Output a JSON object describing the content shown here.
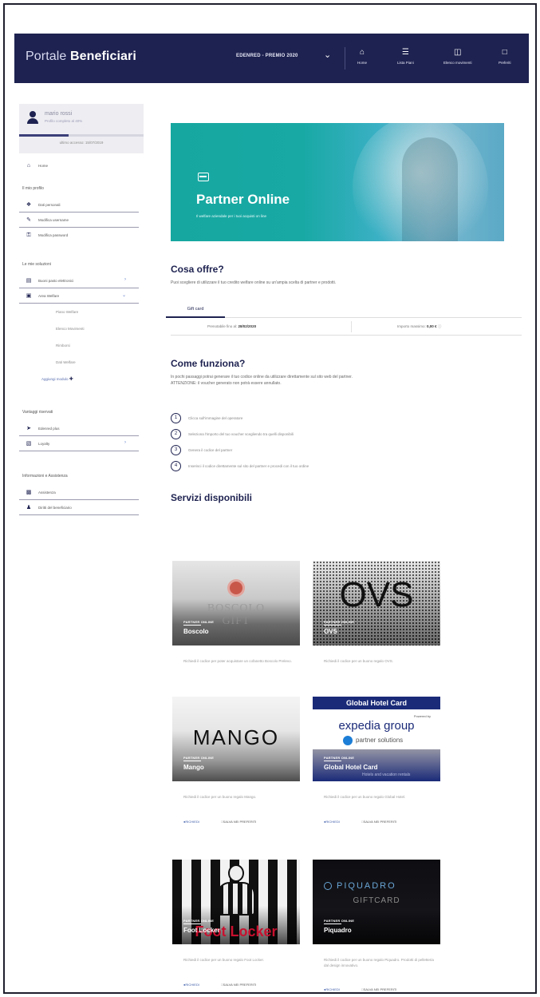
{
  "header": {
    "brand_light": "Portale ",
    "brand_bold": "Beneficiari",
    "program": "EDENRED - PREMIO 2020",
    "nav": [
      {
        "label": "Home",
        "icon": "home-icon"
      },
      {
        "label": "Lista Piani",
        "icon": "list-icon"
      },
      {
        "label": "Elenco movimenti",
        "icon": "movements-icon"
      },
      {
        "label": "Preferiti",
        "icon": "bookmark-icon"
      }
    ]
  },
  "sidebar": {
    "user_name": "mario rossi",
    "profile_status": "Profilo completo al 40%",
    "profile_progress": 0.4,
    "last_access": "ultimo accesso: 15/07/2019",
    "home": "Home",
    "section_profile": "Il mio profilo",
    "profile_items": [
      "Dati personali",
      "Modifica username",
      "Modifica password"
    ],
    "section_solutions": "Le mie soluzioni",
    "solution_items": [
      "Buoni pasto elettronici",
      "Area Welfare"
    ],
    "welfare_sub": [
      "Piano Welfare",
      "Elenco Movimenti",
      "Rimborsi",
      "Dati Welfare"
    ],
    "add_module": "Aggiungi modulo",
    "section_advantages": "Vantaggi riservati",
    "advantage_items": [
      "Edenred plus",
      "Loyalty"
    ],
    "section_info": "Informazioni e Assistenza",
    "info_items": [
      "Assistenza",
      "Diritti del beneficiario"
    ]
  },
  "main": {
    "banner_title": "Partner Online",
    "banner_subtitle": "Il welfare aziendale per i tuoi acquisti on line",
    "offer_title": "Cosa offre?",
    "offer_text": "Puoi scegliere di utilizzare il tuo credito welfare online su un'ampia scelta di partner e prodotti.",
    "tab_label": "Gift card",
    "info_left_label": "Prenotabile fino al:",
    "info_left_value": "28/02/2020",
    "info_right_label": "Importo massimo:",
    "info_right_value": "0,00 €",
    "how_title": "Come funziona?",
    "how_text_1": "In pochi passaggi potrai generare il tuo codice online da utilizzare direttamente sul sito web del partner.",
    "how_text_2": "ATTENZIONE: il voucher generato non potrà essere annullato.",
    "steps": [
      {
        "num": "1",
        "text": "Clicca sull'immagine del operatore"
      },
      {
        "num": "2",
        "text": "Seleziona l'importo del tuo voucher scegliendo tra quelli disponibili"
      },
      {
        "num": "3",
        "text": "Genera il codice del partner"
      },
      {
        "num": "4",
        "text": "Inserisci il codice direttamente sul sito del partner e procedi con il tuo ordine"
      }
    ],
    "services_title": "Servizi disponibili",
    "card_tag": "PARTNER ONLINE",
    "action_request": "RICHIEDI",
    "action_save": "SALVA NEI PREFERITI",
    "cards": [
      {
        "name": "Boscolo",
        "logo": "BOSCOLO",
        "logo2": "GIFT",
        "desc": "Richiedi il codice per poter acquistare un cofanetto Boscolo Prelevo."
      },
      {
        "name": "OVS",
        "logo": "OVS",
        "desc": "Richiedi il codice per un buono regalo OVS."
      },
      {
        "name": "Mango",
        "logo": "MANGO",
        "desc": "Richiedi il codice per un buono regalo Mango."
      },
      {
        "name": "Global Hotel Card",
        "logo": "Global Hotel Card",
        "logo_sub": "Powered by",
        "logo2": "expedia group",
        "logo3": "partner solutions",
        "logo4": "Global Hotel Card",
        "logo5": "Hotels and vacation rentals",
        "desc": "Richiedi il codice per un buono regalo Global Hotel."
      },
      {
        "name": "Foot Locker",
        "logo": "Foot Locker",
        "desc": "Richiedi il codice per un buono regalo Foot Locker."
      },
      {
        "name": "Piquadro",
        "logo": "PIQUADRO",
        "logo2": "GIFTCARD",
        "desc": "Richiedi il codice per un buono regalo Piquadro. Prodotti di pelletteria dal design innovativo."
      }
    ]
  }
}
